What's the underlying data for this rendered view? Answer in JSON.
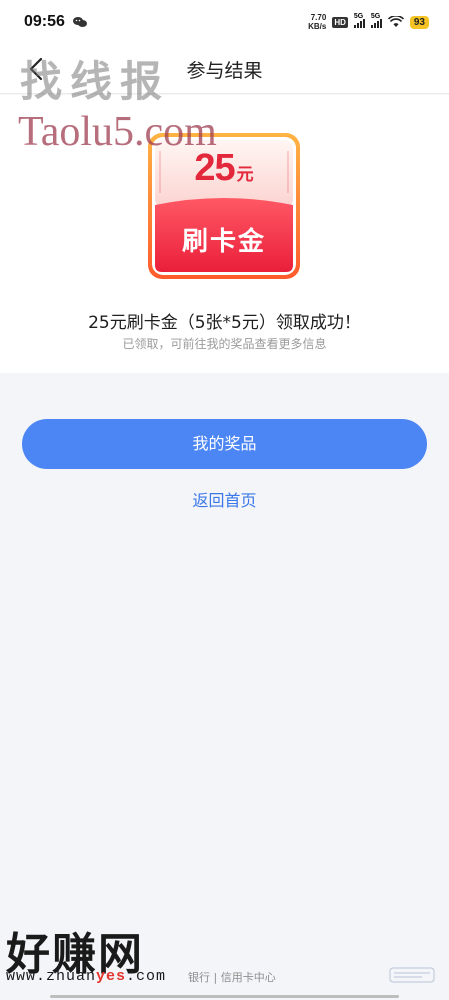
{
  "status_bar": {
    "time": "09:56",
    "net_speed": "7.70",
    "net_unit": "KB/s",
    "hd": "HD",
    "sim1": "5G",
    "sim2": "5G",
    "battery": "93"
  },
  "nav": {
    "title": "参与结果",
    "back_icon": "chevron-left-icon"
  },
  "coupon": {
    "amount": "25",
    "unit": "元",
    "label": "刷卡金",
    "colors": {
      "top": "#fde7e7",
      "bottom": "#f03a47",
      "text": "#e2283a"
    }
  },
  "result": {
    "title": "25元刷卡金（5张*5元）领取成功！",
    "subtitle": "已领取，可前往我的奖品查看更多信息"
  },
  "actions": {
    "primary_label": "我的奖品",
    "secondary_label": "返回首页",
    "accent": "#4c86f4"
  },
  "watermarks": {
    "top_cn": "找线报",
    "taolu": "Taolu5.com",
    "bottom_cn": "好赚网",
    "bottom_url_prefix": "www.zhuan",
    "bottom_url_accent": "yes",
    "bottom_url_suffix": ".com"
  },
  "footer": {
    "text": "银行 | 信用卡中心"
  }
}
